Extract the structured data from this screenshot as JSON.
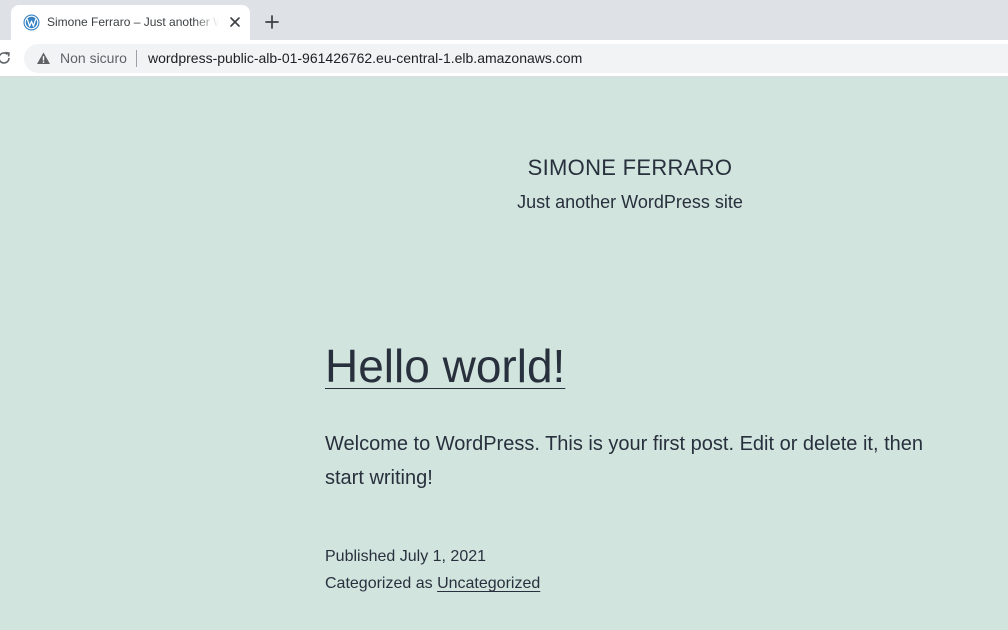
{
  "browser": {
    "tab": {
      "title": "Simone Ferraro – Just another WordPress site",
      "favicon": "wordpress-icon"
    },
    "new_tab_icon": "plus-icon",
    "close_icon": "close-icon",
    "reload_icon": "reload-icon",
    "omnibox": {
      "security_icon": "warning-icon",
      "security_label": "Non sicuro",
      "url": "wordpress-public-alb-01-961426762.eu-central-1.elb.amazonaws.com"
    }
  },
  "site": {
    "title": "SIMONE FERRARO",
    "description": "Just another WordPress site",
    "background_color": "#d1e4dd",
    "text_color": "#28303d"
  },
  "post": {
    "title": "Hello world!",
    "body": "Welcome to WordPress. This is your first post. Edit or delete it, then start writing!",
    "published_label": "Published",
    "published_date": "July 1, 2021",
    "category_label": "Categorized as",
    "category": "Uncategorized"
  }
}
